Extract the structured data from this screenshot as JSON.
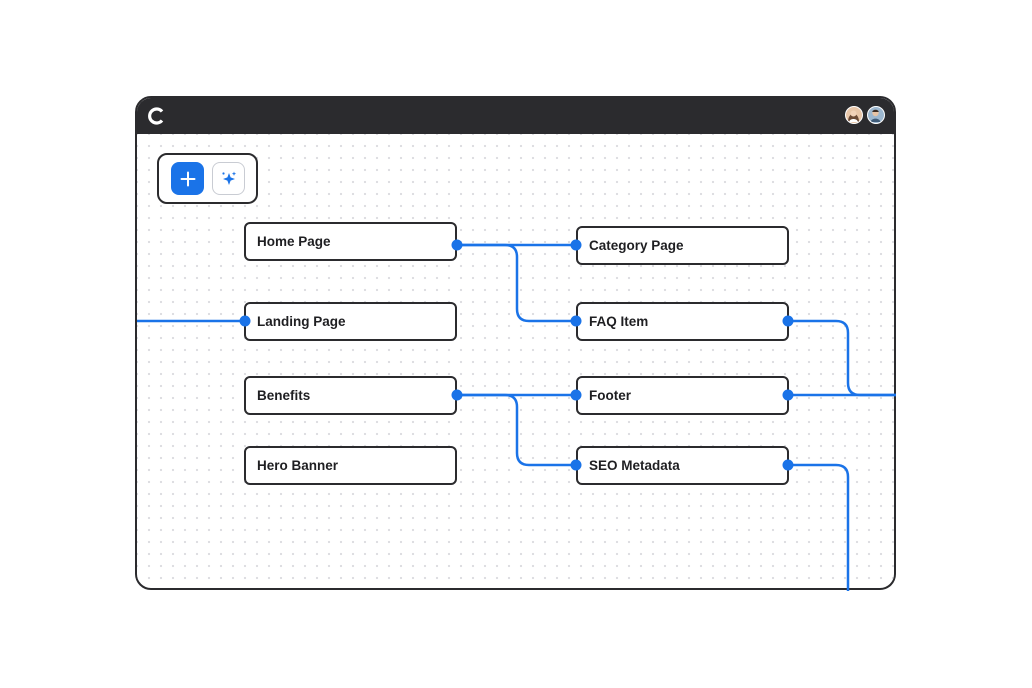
{
  "colors": {
    "accent": "#1a73e8",
    "window_frame": "#2b2b2e",
    "node_border": "#2b2b2e"
  },
  "titlebar": {
    "logo_icon": "brand-c-logo",
    "collaborators": [
      "avatar-woman",
      "avatar-man"
    ]
  },
  "toolbar": {
    "add_icon": "plus-icon",
    "ai_icon": "sparkles-icon"
  },
  "nodes": {
    "home_page": "Home Page",
    "landing_page": "Landing Page",
    "benefits": "Benefits",
    "hero_banner": "Hero Banner",
    "category_page": "Category Page",
    "faq_item": "FAQ Item",
    "footer": "Footer",
    "seo_metadata": "SEO Metadata"
  },
  "connections": [
    [
      "Home Page",
      "Category Page"
    ],
    [
      "Home Page",
      "FAQ Item"
    ],
    [
      "Benefits",
      "Footer"
    ],
    [
      "Benefits",
      "SEO Metadata"
    ],
    [
      "offscreen-left",
      "Landing Page"
    ],
    [
      "FAQ Item",
      "offscreen-right"
    ],
    [
      "Footer",
      "offscreen-right"
    ],
    [
      "SEO Metadata",
      "offscreen-bottom"
    ]
  ]
}
